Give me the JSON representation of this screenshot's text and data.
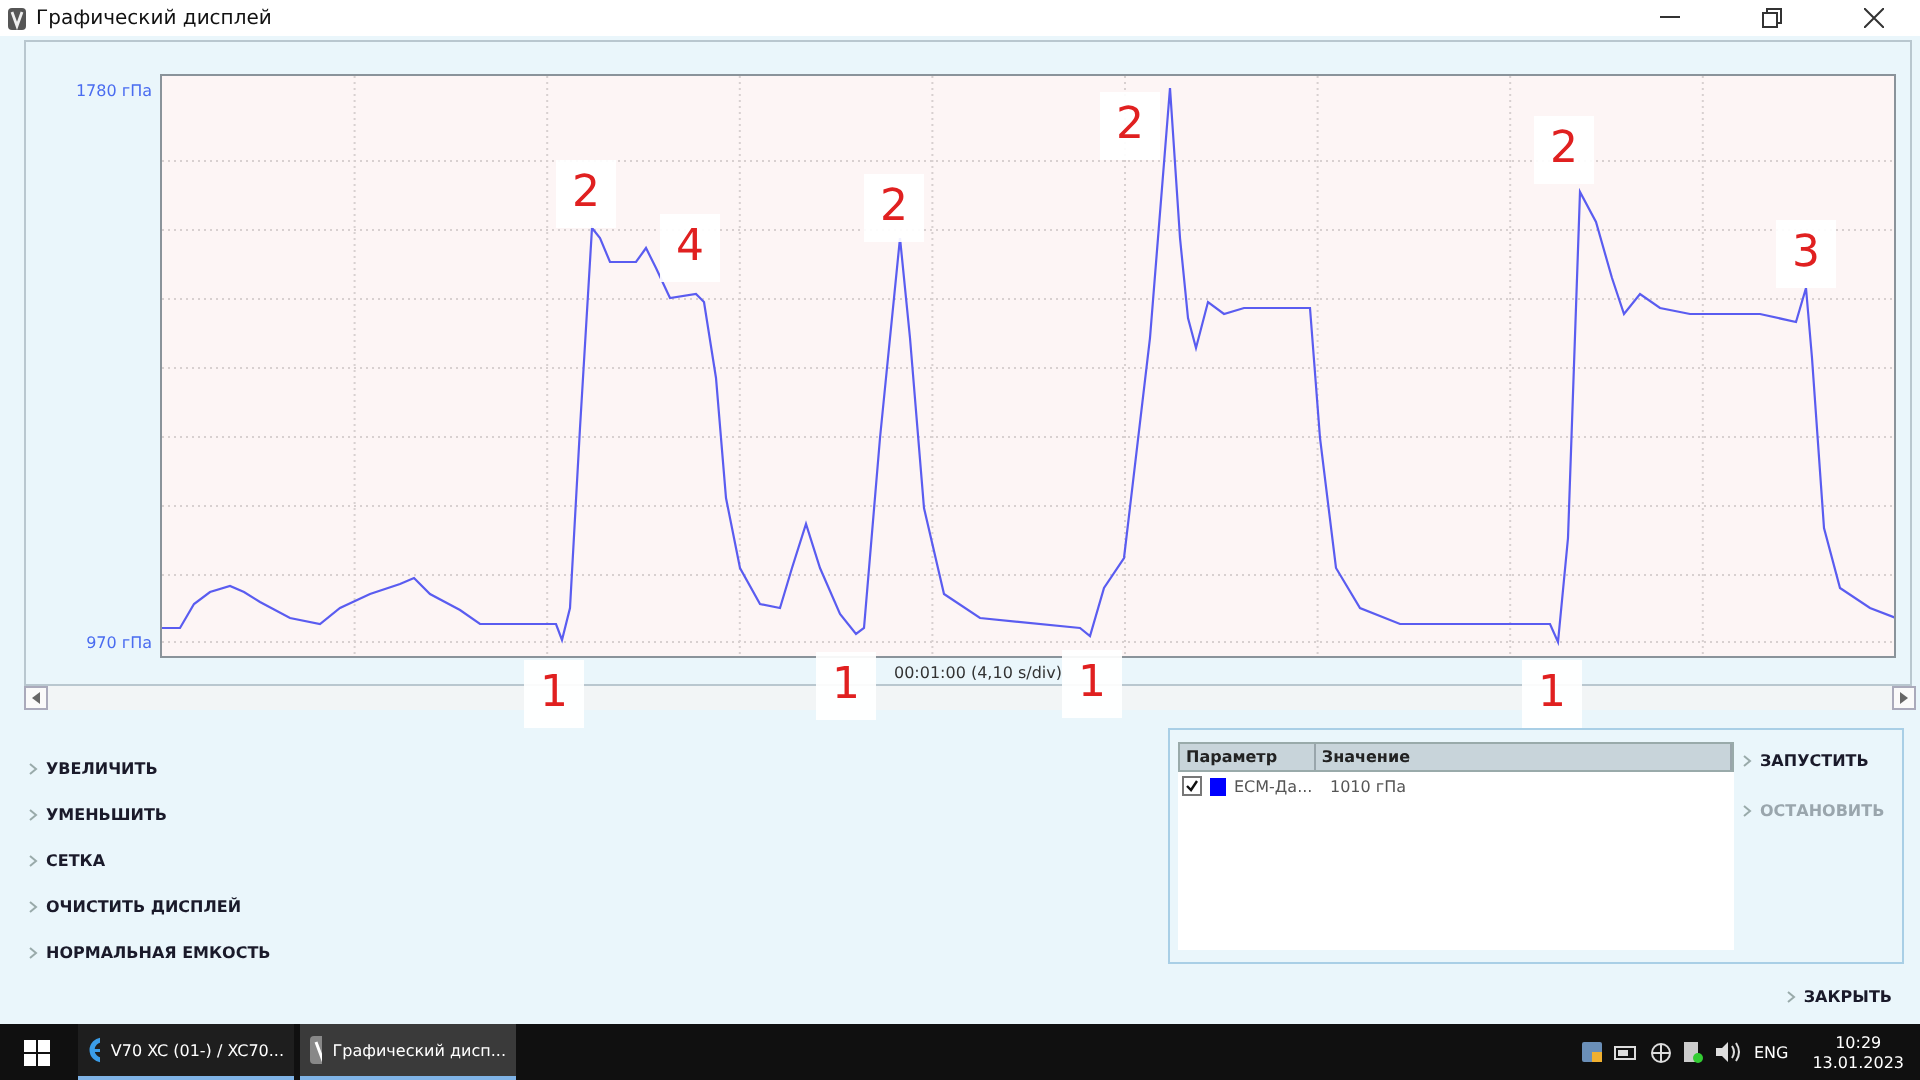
{
  "window": {
    "title": "Графический дисплей"
  },
  "chart": {
    "y_max_label": "1780 гПа",
    "y_min_label": "970 гПа",
    "x_label": "00:01:00 (4,10 s/div)"
  },
  "annotations": [
    {
      "text": "2"
    },
    {
      "text": "4"
    },
    {
      "text": "2"
    },
    {
      "text": "2"
    },
    {
      "text": "2"
    },
    {
      "text": "3"
    },
    {
      "text": "1"
    },
    {
      "text": "1"
    },
    {
      "text": "1"
    },
    {
      "text": "1"
    }
  ],
  "commands": [
    {
      "label": "УВЕЛИЧИТЬ"
    },
    {
      "label": "УМЕНЬШИТЬ"
    },
    {
      "label": "СЕТКА"
    },
    {
      "label": "ОЧИСТИТЬ ДИСПЛЕЙ"
    },
    {
      "label": "НОРМАЛЬНАЯ ЕМКОСТЬ"
    }
  ],
  "table": {
    "columns": [
      "Параметр",
      "Значение"
    ],
    "rows": [
      {
        "checked": true,
        "color": "#0000ff",
        "parameter": "ECM-Да...",
        "value": "1010 гПа"
      }
    ]
  },
  "actions": [
    {
      "label": "ЗАПУСТИТЬ",
      "disabled": false
    },
    {
      "label": "ОСТАНОВИТЬ",
      "disabled": true
    }
  ],
  "close_button": "ЗАКРЫТЬ",
  "taskbar": {
    "apps": [
      {
        "label": "V70 XC (01-) / XC70...",
        "selected": false
      },
      {
        "label": "Графический дисп...",
        "selected": true
      }
    ],
    "language": "ENG",
    "time": "10:29",
    "date": "13.01.2023"
  }
}
